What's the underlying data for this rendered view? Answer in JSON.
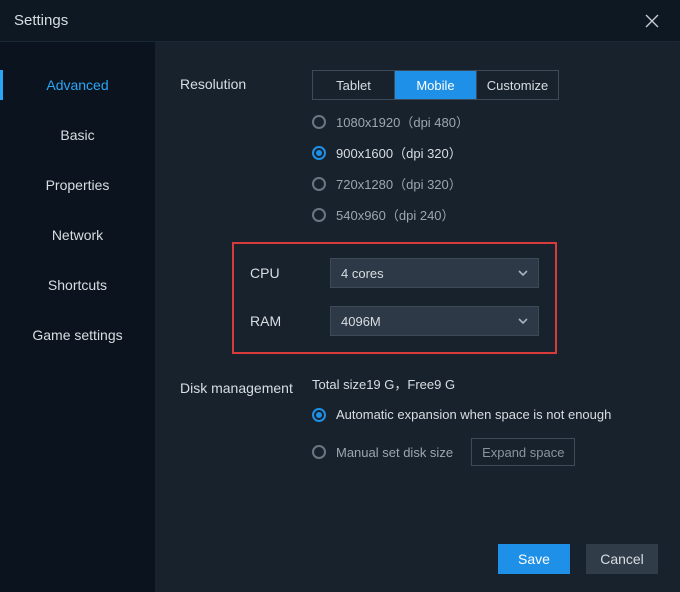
{
  "window": {
    "title": "Settings"
  },
  "sidebar": {
    "items": [
      {
        "label": "Advanced",
        "active": true
      },
      {
        "label": "Basic"
      },
      {
        "label": "Properties"
      },
      {
        "label": "Network"
      },
      {
        "label": "Shortcuts"
      },
      {
        "label": "Game settings"
      }
    ]
  },
  "resolution": {
    "label": "Resolution",
    "tabs": [
      {
        "label": "Tablet"
      },
      {
        "label": "Mobile",
        "active": true
      },
      {
        "label": "Customize"
      }
    ],
    "options": [
      {
        "label": "1080x1920（dpi 480）"
      },
      {
        "label": "900x1600（dpi 320）",
        "selected": true
      },
      {
        "label": "720x1280（dpi 320）"
      },
      {
        "label": "540x960（dpi 240）"
      }
    ]
  },
  "cpu": {
    "label": "CPU",
    "value": "4 cores"
  },
  "ram": {
    "label": "RAM",
    "value": "4096M"
  },
  "disk": {
    "label": "Disk management",
    "status": "Total size19 G，Free9 G",
    "auto_label": "Automatic expansion when space is not enough",
    "manual_label": "Manual set disk size",
    "expand_label": "Expand space",
    "selected": "auto"
  },
  "footer": {
    "save": "Save",
    "cancel": "Cancel"
  }
}
